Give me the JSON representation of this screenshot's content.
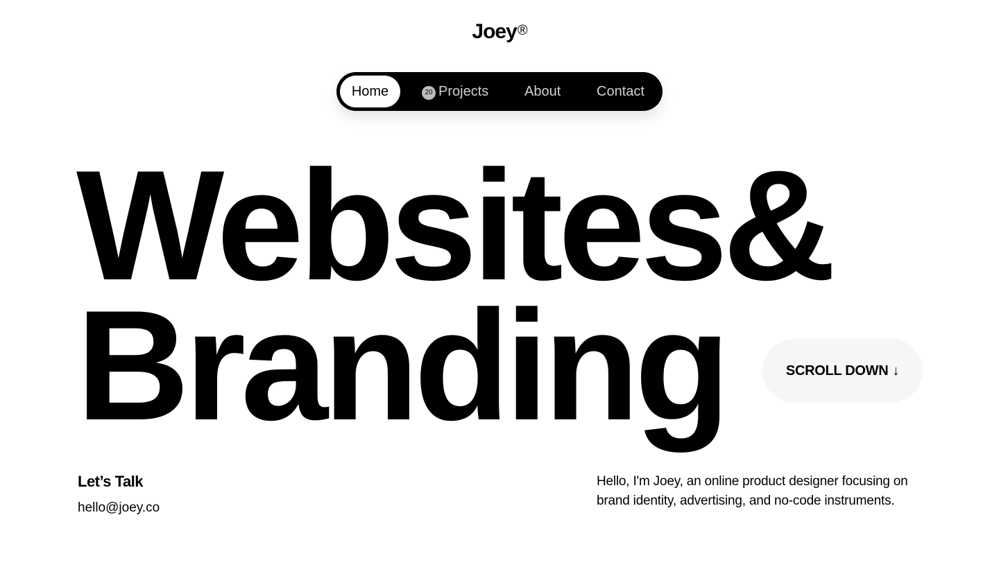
{
  "header": {
    "logo_text": "Joey",
    "logo_mark": "®"
  },
  "nav": {
    "items": [
      {
        "label": "Home",
        "active": true
      },
      {
        "label": "Projects",
        "badge": "20"
      },
      {
        "label": "About"
      },
      {
        "label": "Contact"
      }
    ]
  },
  "hero": {
    "line1": "Websites&",
    "line2": "Branding"
  },
  "scroll": {
    "label": "SCROLL DOWN",
    "icon": "arrow-down-icon",
    "arrow": "↓"
  },
  "contact": {
    "heading": "Let’s Talk",
    "email": "hello@joey.co"
  },
  "bio": {
    "text": "Hello, I'm Joey, an online product designer focusing on brand identity, advertising, and no-code instruments."
  },
  "colors": {
    "background": "#ffffff",
    "text": "#000000",
    "nav_background": "#000000",
    "nav_inactive_text": "#d0d0d0",
    "button_background": "#f6f6f6"
  }
}
